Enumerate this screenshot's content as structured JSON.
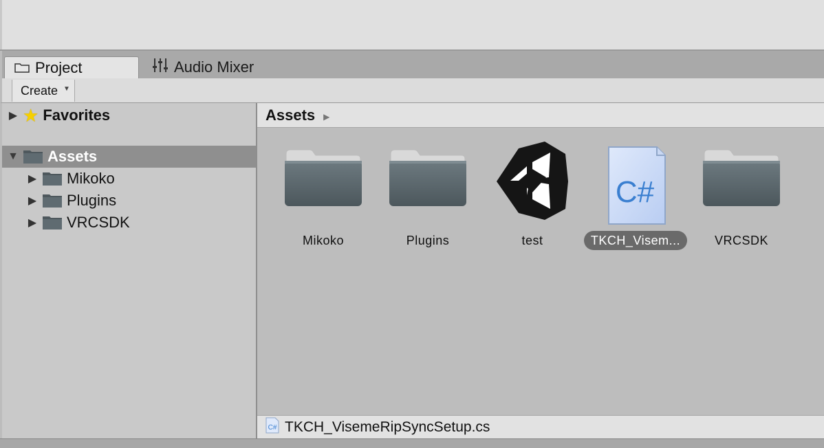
{
  "tabs": {
    "project_label": "Project",
    "project_icon": "folder-icon",
    "mixer_label": "Audio Mixer",
    "mixer_icon": "sliders-icon"
  },
  "toolbar": {
    "create_label": "Create"
  },
  "sidebar": {
    "favorites_label": "Favorites",
    "assets_label": "Assets",
    "children": [
      {
        "label": "Mikoko"
      },
      {
        "label": "Plugins"
      },
      {
        "label": "VRCSDK"
      }
    ]
  },
  "main": {
    "breadcrumb": "Assets",
    "items": [
      {
        "label": "Mikoko",
        "type": "folder"
      },
      {
        "label": "Plugins",
        "type": "folder"
      },
      {
        "label": "test",
        "type": "unity-scene"
      },
      {
        "label": "TKCH_Visem...",
        "type": "csharp-script",
        "selected": true
      },
      {
        "label": "VRCSDK",
        "type": "folder"
      }
    ]
  },
  "status": {
    "selected_file": "TKCH_VisemeRipSyncSetup.cs"
  },
  "colors": {
    "folder": "#5a656b",
    "selection": "#8f8f8f",
    "csharp_blue": "#3a7fd0"
  }
}
